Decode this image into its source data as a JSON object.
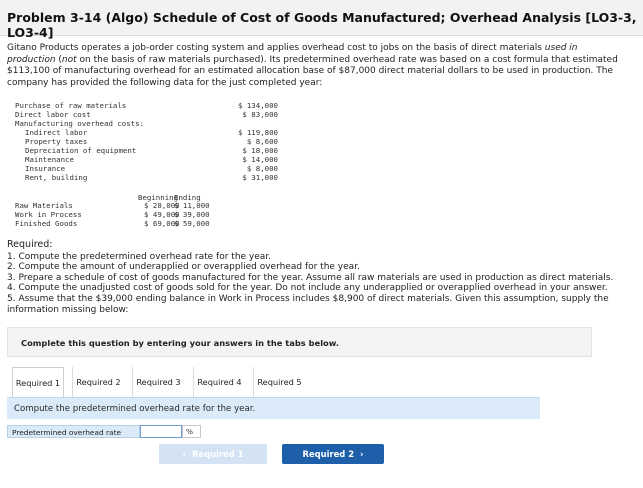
{
  "header": {
    "title": "Problem 3-14 (Algo) Schedule of Cost of Goods Manufactured; Overhead Analysis [LO3-3, LO3-4]"
  },
  "intro": {
    "line1_a": "Gitano Products operates a job-order costing system and applies overhead cost to jobs on the basis of direct materials ",
    "line1_b": "used in",
    "line2_a": "production",
    "line2_b": " (",
    "line2_c": "not",
    "line2_d": " on the basis of raw materials purchased). Its predetermined overhead rate was based on a cost formula that estimated",
    "line3": "$113,100 of manufacturing overhead for an estimated allocation base of $87,000 direct material dollars to be used in production. The",
    "line4": "company has provided the following data for the just completed year:"
  },
  "costs": [
    {
      "label": "Purchase of raw materials",
      "value": "$ 134,000"
    },
    {
      "label": "Direct labor cost",
      "value": "$ 83,000"
    },
    {
      "label": "Manufacturing overhead costs:",
      "value": ""
    },
    {
      "label": "  Indirect labor",
      "value": "$ 119,800"
    },
    {
      "label": "  Property taxes",
      "value": "$ 8,600"
    },
    {
      "label": "  Depreciation of equipment",
      "value": "$ 18,000"
    },
    {
      "label": "  Maintenance",
      "value": "$ 14,000"
    },
    {
      "label": "  Insurance",
      "value": "$ 8,000"
    },
    {
      "label": "  Rent, building",
      "value": "$ 31,000"
    }
  ],
  "inventory": {
    "col_beginning": "Beginning",
    "col_ending": "Ending",
    "rows": [
      {
        "label": "Raw Materials",
        "beginning": "$ 28,000",
        "ending": "$ 11,000"
      },
      {
        "label": "Work in Process",
        "beginning": "$ 49,000",
        "ending": "$ 39,000"
      },
      {
        "label": "Finished Goods",
        "beginning": "$ 69,000",
        "ending": "$ 59,000"
      }
    ]
  },
  "required": {
    "heading": "Required:",
    "items": [
      "1. Compute the predetermined overhead rate for the year.",
      "2. Compute the amount of underapplied or overapplied overhead for the year.",
      "3. Prepare a schedule of cost of goods manufactured for the year. Assume all raw materials are used in production as direct materials.",
      "4. Compute the unadjusted cost of goods sold for the year. Do not include any underapplied or overapplied overhead in your answer.",
      "5. Assume that the $39,000 ending balance in Work in Process includes $8,900 of direct materials. Given this assumption, supply the",
      "information missing below:"
    ]
  },
  "instructions": "Complete this question by entering your answers in the tabs below.",
  "tabs": [
    "Required 1",
    "Required 2",
    "Required 3",
    "Required 4",
    "Required 5"
  ],
  "active_tab": "Required 1",
  "panel_prompt": "Compute the predetermined overhead rate for the year.",
  "answer": {
    "label": "Predetermined overhead rate",
    "value": "",
    "unit": "%"
  },
  "nav": {
    "prev_label": "Required 1",
    "next_label": "Required 2",
    "prev_icon": "chevron-left-icon",
    "next_icon": "chevron-right-icon"
  },
  "colors": {
    "panel_bg": "#daeaf8",
    "next_button": "#1d5fa8",
    "prev_button_disabled": "#d3e3f3"
  }
}
